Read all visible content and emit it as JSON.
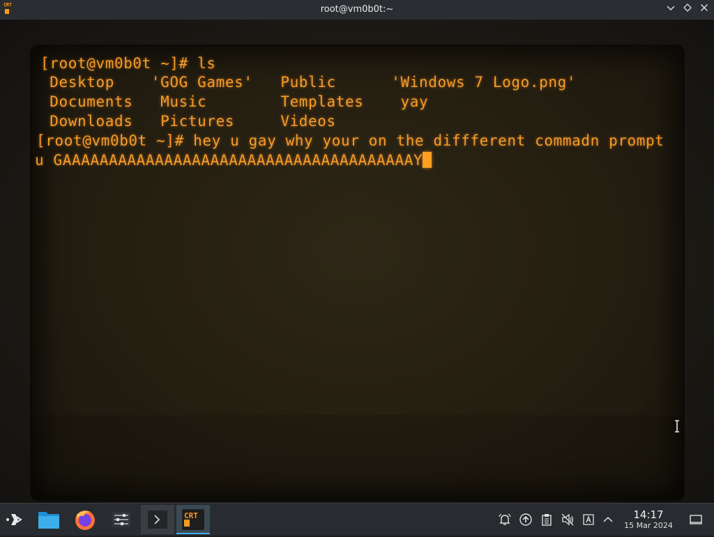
{
  "window": {
    "title": "root@vm0b0t:~",
    "icon_label": "CRT",
    "controls": [
      "chevron-down-icon",
      "diamond-icon",
      "close-icon"
    ]
  },
  "terminal": {
    "lines": [
      "[root@vm0b0t ~]# ls",
      " Desktop    'GOG Games'   Public      'Windows 7 Logo.png'",
      " Documents   Music        Templates    yay",
      " Downloads   Pictures     Videos",
      "[root@vm0b0t ~]# hey u gay why your on the diffferent commadn prompt",
      "u GAAAAAAAAAAAAAAAAAAAAAAAAAAAAAAAAAAAAAAY"
    ],
    "text_color": "#f49a2a"
  },
  "taskbar": {
    "apps": [
      {
        "name": "app-launcher",
        "icon": "app-launcher-icon"
      },
      {
        "name": "file-manager",
        "icon": "folder-icon"
      },
      {
        "name": "firefox",
        "icon": "firefox-icon"
      },
      {
        "name": "system-settings",
        "icon": "settings-sliders-icon"
      },
      {
        "name": "konsole",
        "icon": "terminal-icon"
      },
      {
        "name": "cool-retro-term",
        "icon": "crt-icon",
        "label": "CRT"
      }
    ],
    "tray": [
      "notifications-icon",
      "updates-icon",
      "clipboard-icon",
      "volume-muted-icon",
      "keyboard-layout-icon",
      "expand-tray-icon"
    ],
    "clock": {
      "time": "14:17",
      "date": "15 Mar 2024"
    },
    "accent_color": "#3daee9"
  }
}
